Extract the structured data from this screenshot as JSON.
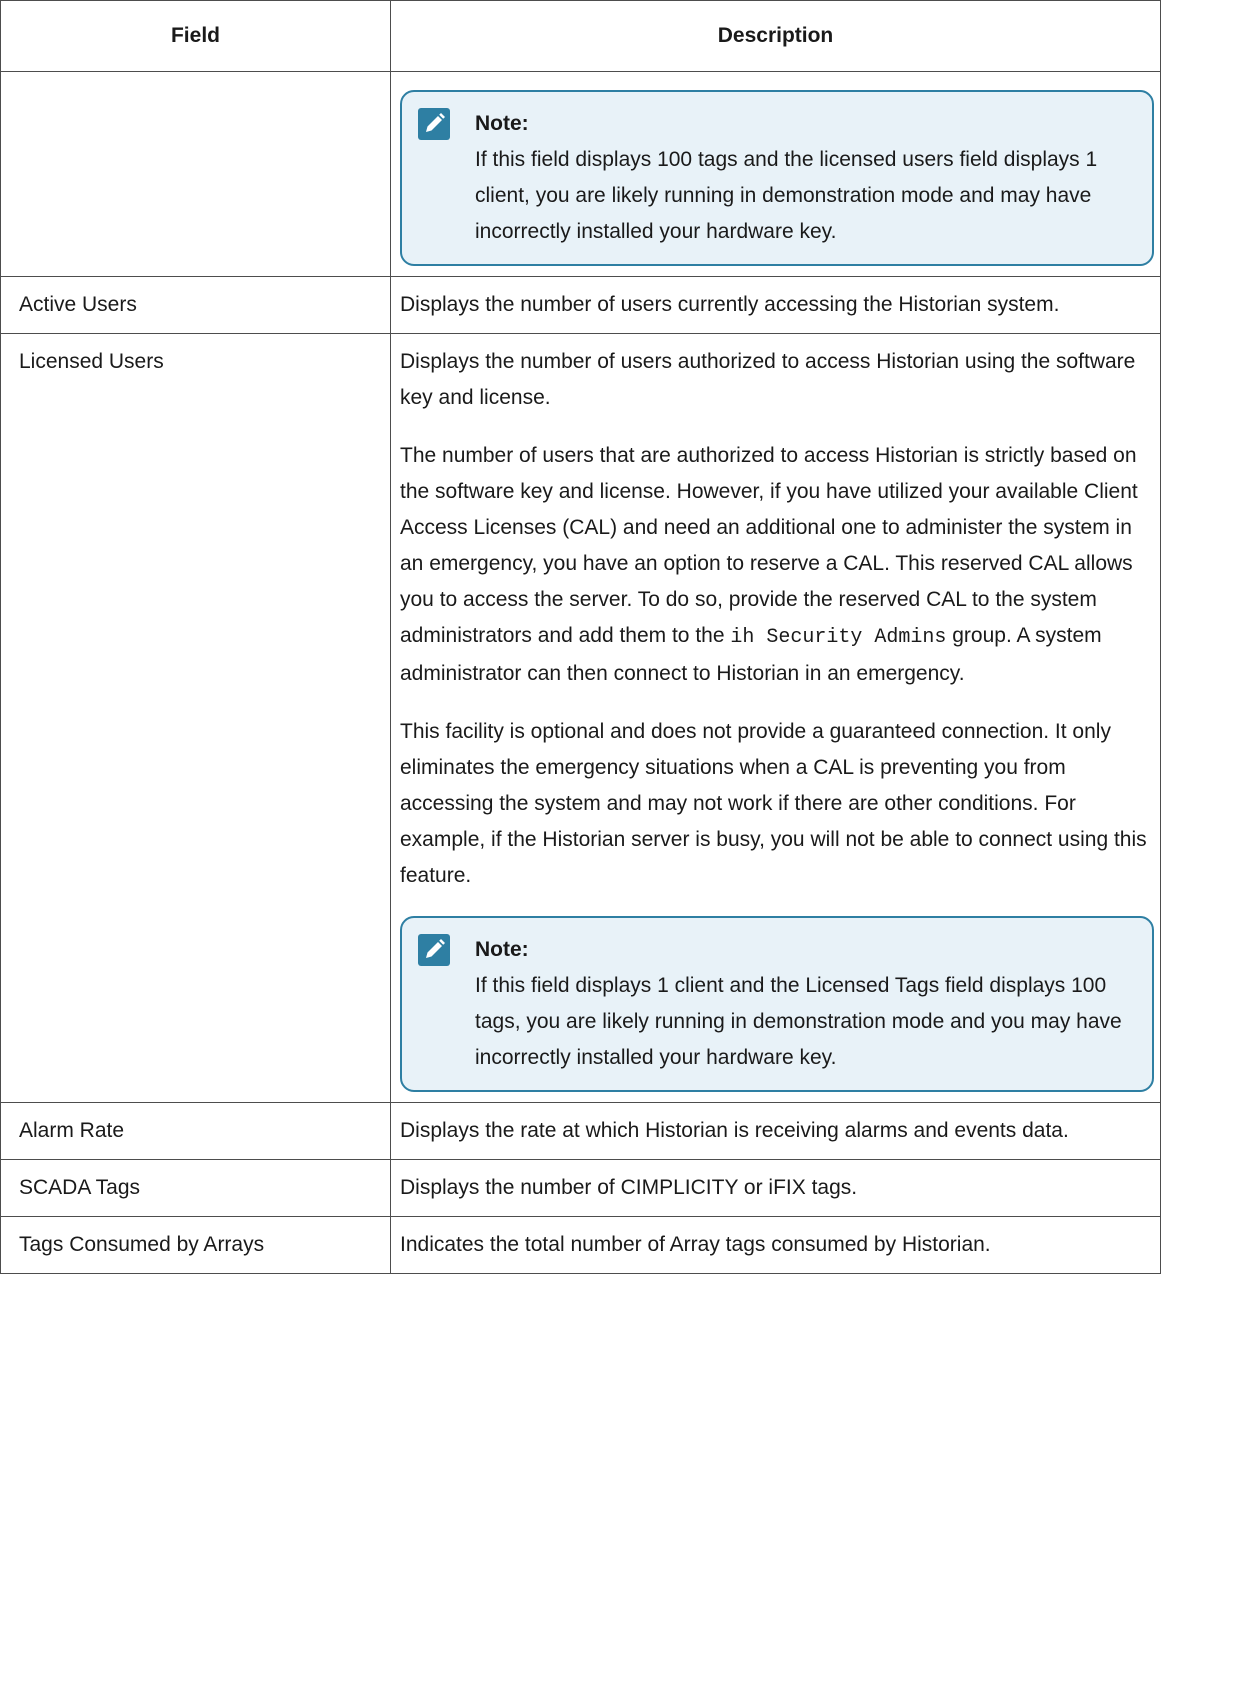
{
  "table": {
    "headers": [
      "Field",
      "Description"
    ],
    "rows": [
      {
        "field": "",
        "paragraphs": [],
        "note": {
          "title": "Note:",
          "text": "If this field displays 100 tags and the licensed users field displays 1 client, you are likely running in demonstration mode and may have incorrectly installed your hardware key."
        }
      },
      {
        "field": "Active Users",
        "paragraphs": [
          "Displays the number of users currently accessing the Historian system."
        ]
      },
      {
        "field": "Licensed Users",
        "paragraphs": [
          "Displays the number of users authorized to access Historian using the software key and license.",
          {
            "before": "The number of users that are authorized to access Historian is strictly based on the software key and license. However, if you have utilized your available Client Access Licenses (CAL) and need an additional one to administer the system in an emergency, you have an option to reserve a CAL. This reserved CAL allows you to access the server. To do so, provide the reserved CAL to the system administrators and add them to the ",
            "code": "ih Security Admins",
            "after": " group. A system administrator can then connect to Historian in an emergency."
          },
          "This facility is optional and does not provide a guaranteed connection. It only eliminates the emergency situations when a CAL is preventing you from accessing the system and may not work if there are other conditions. For example, if the Historian server is busy, you will not be able to connect using this feature."
        ],
        "note": {
          "title": "Note:",
          "text": "If this field displays 1 client and the Licensed Tags field displays 100 tags, you are likely running in demonstration mode and you may have incorrectly installed your hardware key."
        }
      },
      {
        "field": "Alarm Rate",
        "paragraphs": [
          "Displays the rate at which Historian is receiving alarms and events data."
        ]
      },
      {
        "field": "SCADA Tags",
        "paragraphs": [
          "Displays the number of CIMPLICITY or iFIX tags."
        ]
      },
      {
        "field": "Tags Consumed by Arrays",
        "paragraphs": [
          "Indicates the total number of Array tags consumed by Historian."
        ]
      }
    ]
  }
}
